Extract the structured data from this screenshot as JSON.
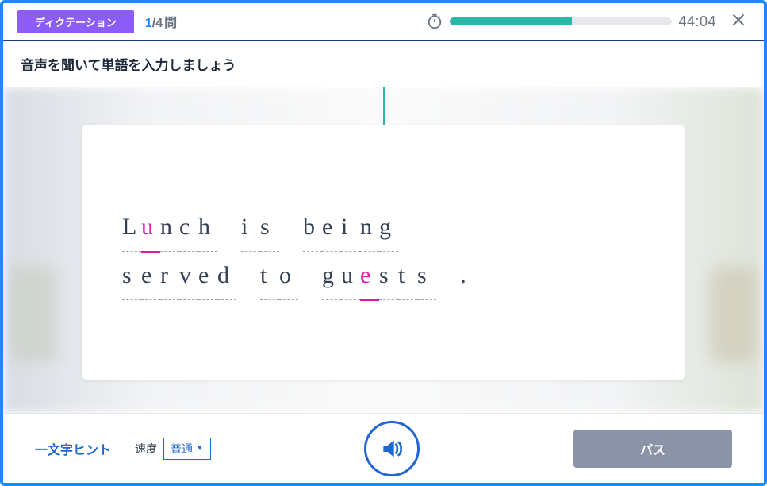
{
  "header": {
    "mode_label": "ディクテーション",
    "current_q": "1",
    "total_q": "4",
    "q_suffix": "問",
    "time_remaining": "44:04",
    "time_fill_pct": 55
  },
  "instruction": "音声を聞いて単語を入力しましょう",
  "sentence": {
    "words": [
      {
        "chars": [
          "L",
          "u",
          "n",
          "c",
          "h"
        ],
        "hints": [
          1
        ]
      },
      {
        "chars": [
          "i",
          "s"
        ],
        "hints": []
      },
      {
        "chars": [
          "b",
          "e",
          "i",
          "n",
          "g"
        ],
        "hints": []
      },
      {
        "chars": [
          "s",
          "e",
          "r",
          "v",
          "e",
          "d"
        ],
        "hints": []
      },
      {
        "chars": [
          "t",
          "o"
        ],
        "hints": []
      },
      {
        "chars": [
          "g",
          "u",
          "e",
          "s",
          "t",
          "s"
        ],
        "hints": [
          2
        ]
      }
    ],
    "punct": "."
  },
  "footer": {
    "hint_label": "一文字ヒント",
    "speed_label": "速度",
    "speed_value": "普通",
    "pass_label": "パス"
  },
  "icons": {
    "timer": "timer-icon",
    "close": "close-icon",
    "speaker": "speaker-icon",
    "caret": "▼"
  },
  "colors": {
    "accent_blue": "#1e88ff",
    "teal": "#2bb6a8",
    "purple": "#8b5cf6",
    "hint_pink": "#e11da3",
    "gray_btn": "#8a94a6"
  }
}
